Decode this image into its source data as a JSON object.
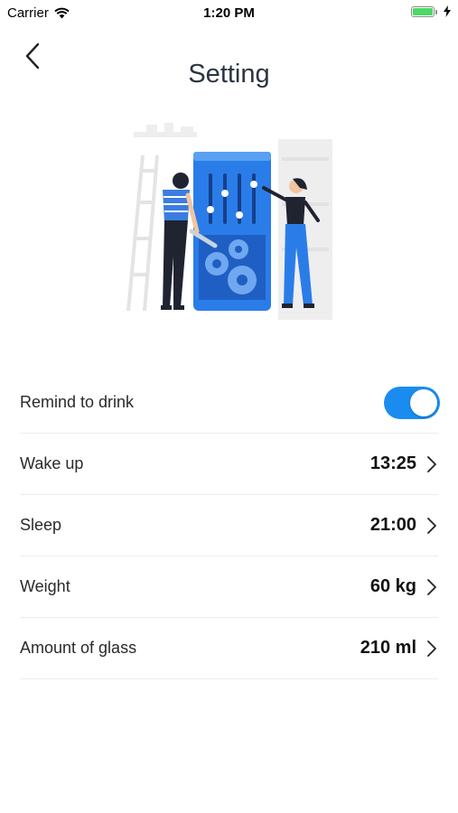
{
  "status_bar": {
    "carrier": "Carrier",
    "time": "1:20 PM",
    "battery_level": 1.0,
    "battery_color": "#4cd964"
  },
  "header": {
    "title": "Setting",
    "back_icon": "chevron-left-icon"
  },
  "illustration": {
    "subject": "people-adjusting-settings-illustration"
  },
  "settings": {
    "remind": {
      "label": "Remind to drink",
      "enabled": true,
      "toggle_color": "#1a8cf0"
    },
    "wake_up": {
      "label": "Wake up",
      "value": "13:25"
    },
    "sleep": {
      "label": "Sleep",
      "value": "21:00"
    },
    "weight": {
      "label": "Weight",
      "value": "60 kg"
    },
    "glass": {
      "label": "Amount of glass",
      "value": "210 ml"
    }
  },
  "colors": {
    "accent": "#1a8cf0",
    "divider": "#ececec"
  }
}
